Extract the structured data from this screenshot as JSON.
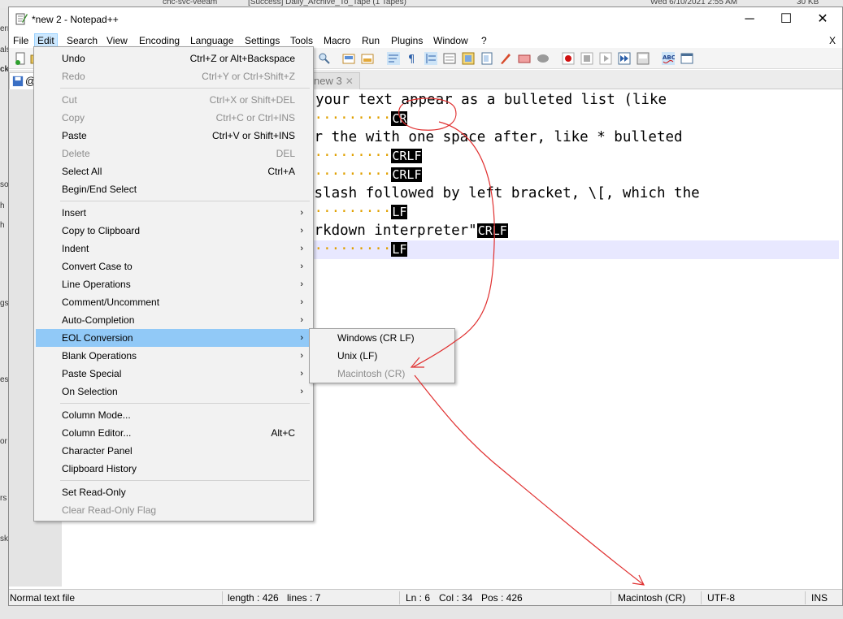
{
  "background": {
    "taskbar_texts": [
      "chc-svc-veeam",
      "[Success] Daily_Archive_To_Tape (1 Tapes)",
      "Wed 6/10/2021 2:55 AM",
      "30 KB"
    ],
    "left_edge_letters": [
      "err",
      "als",
      "ck",
      "so",
      "h",
      "h",
      "gs",
      "es",
      "or",
      "rs",
      "sk"
    ]
  },
  "window": {
    "title": "*new 2 - Notepad++",
    "minimize": "─",
    "maximize": "☐",
    "close": "✕",
    "menubar_close": "X"
  },
  "menubar": {
    "items": [
      "File",
      "Edit",
      "Search",
      "View",
      "Encoding",
      "Language",
      "Settings",
      "Tools",
      "Macro",
      "Run",
      "Plugins",
      "Window",
      "?"
    ],
    "active": "Edit"
  },
  "tabs": [
    {
      "label": "@",
      "active": true
    },
    {
      "label": "new 3",
      "close": "✕"
    }
  ],
  "editor": {
    "lines": [
      {
        "text": "e your text appear as a bulleted list (like ",
        "dots": "",
        "eol": ""
      },
      {
        "text": "",
        "dots": "··········",
        "eol": "CR"
      },
      {
        "text": "ar the with one space after, like * bulleted ",
        "dots": "",
        "eol": ""
      },
      {
        "text": "",
        "dots": "··········",
        "eol": "CRLF"
      },
      {
        "text": "",
        "dots": "··········",
        "eol": "CRLF"
      },
      {
        "text": "kslash followed by left bracket, \\[, which the ",
        "dots": "",
        "eol": ""
      },
      {
        "text": "",
        "dots": "··········",
        "eol": "LF"
      },
      {
        "text": "arkdown interpreter\"",
        "dots": "",
        "eol": "CRLF"
      },
      {
        "text": "",
        "dots": "··········",
        "eol": "LF"
      }
    ]
  },
  "edit_menu": {
    "items": [
      {
        "label": "Undo",
        "shortcut": "Ctrl+Z or Alt+Backspace",
        "disabled": false
      },
      {
        "label": "Redo",
        "shortcut": "Ctrl+Y or Ctrl+Shift+Z",
        "disabled": true
      },
      {
        "label": "Cut",
        "shortcut": "Ctrl+X or Shift+DEL",
        "disabled": true
      },
      {
        "label": "Copy",
        "shortcut": "Ctrl+C or Ctrl+INS",
        "disabled": true
      },
      {
        "label": "Paste",
        "shortcut": "Ctrl+V or Shift+INS",
        "disabled": false
      },
      {
        "label": "Delete",
        "shortcut": "DEL",
        "disabled": true
      },
      {
        "label": "Select All",
        "shortcut": "Ctrl+A",
        "disabled": false
      },
      {
        "label": "Begin/End Select",
        "shortcut": "",
        "disabled": false
      },
      {
        "label": "Insert",
        "submenu": true
      },
      {
        "label": "Copy to Clipboard",
        "submenu": true
      },
      {
        "label": "Indent",
        "submenu": true
      },
      {
        "label": "Convert Case to",
        "submenu": true
      },
      {
        "label": "Line Operations",
        "submenu": true
      },
      {
        "label": "Comment/Uncomment",
        "submenu": true
      },
      {
        "label": "Auto-Completion",
        "submenu": true
      },
      {
        "label": "EOL Conversion",
        "submenu": true,
        "highlighted": true
      },
      {
        "label": "Blank Operations",
        "submenu": true
      },
      {
        "label": "Paste Special",
        "submenu": true
      },
      {
        "label": "On Selection",
        "submenu": true
      },
      {
        "label": "Column Mode...",
        "shortcut": ""
      },
      {
        "label": "Column Editor...",
        "shortcut": "Alt+C"
      },
      {
        "label": "Character Panel",
        "shortcut": ""
      },
      {
        "label": "Clipboard History",
        "shortcut": ""
      },
      {
        "label": "Set Read-Only",
        "shortcut": ""
      },
      {
        "label": "Clear Read-Only Flag",
        "shortcut": "",
        "disabled": true
      }
    ],
    "submenu_arrow": "›"
  },
  "eol_submenu": {
    "items": [
      {
        "label": "Windows (CR LF)",
        "disabled": false
      },
      {
        "label": "Unix (LF)",
        "disabled": false
      },
      {
        "label": "Macintosh (CR)",
        "disabled": true
      }
    ]
  },
  "statusbar": {
    "file_type": "Normal text file",
    "length": "length : 426",
    "lines": "lines : 7",
    "ln": "Ln : 6",
    "col": "Col : 34",
    "pos": "Pos : 426",
    "eol": "Macintosh (CR)",
    "encoding": "UTF-8",
    "mode": "INS"
  },
  "colors": {
    "annotation_red": "#e03030",
    "menu_highlight": "#91c9f7",
    "eol_marker_bg": "#000000",
    "whitespace_dot": "#e0a000"
  }
}
